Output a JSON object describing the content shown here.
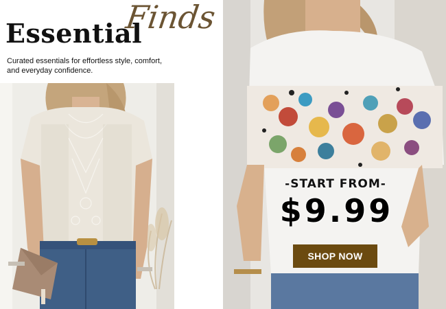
{
  "headline": {
    "title_main": "Essential",
    "title_script": "Finds",
    "tagline": "Curated essentials for effortless style, comfort, and everyday confidence."
  },
  "promo": {
    "label": "-START FROM-",
    "price": "$9.99",
    "cta": "SHOP NOW"
  },
  "colors": {
    "accent_brown": "#6b4a10",
    "script_brown": "#6b5433"
  }
}
